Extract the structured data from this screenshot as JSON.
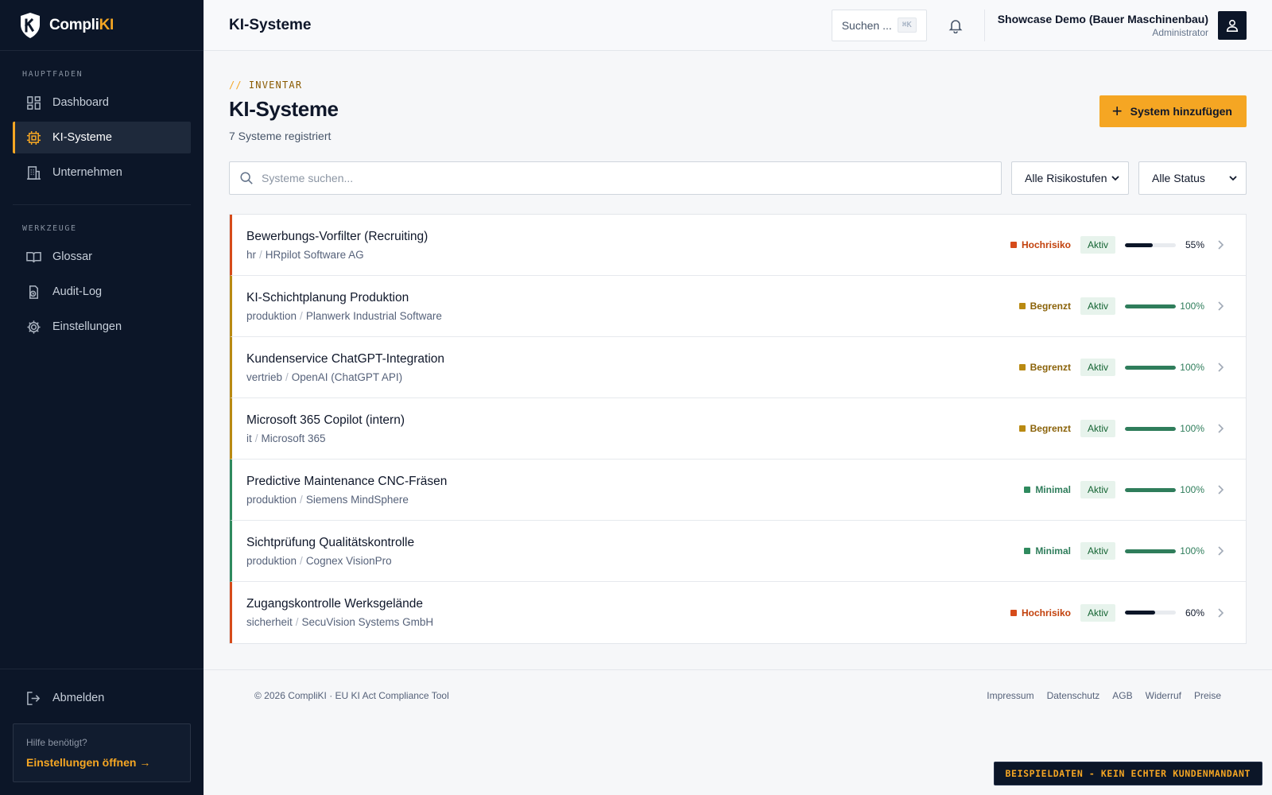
{
  "brand": {
    "name_main": "Compli",
    "name_accent": "KI"
  },
  "sidebar": {
    "sections": [
      {
        "title": "HAUPTFADEN",
        "items": [
          {
            "label": "Dashboard",
            "icon": "dashboard-icon"
          },
          {
            "label": "KI-Systeme",
            "icon": "chip-icon",
            "active": true
          },
          {
            "label": "Unternehmen",
            "icon": "building-icon"
          }
        ]
      },
      {
        "title": "WERKZEUGE",
        "items": [
          {
            "label": "Glossar",
            "icon": "book-icon"
          },
          {
            "label": "Audit-Log",
            "icon": "audit-log-icon"
          },
          {
            "label": "Einstellungen",
            "icon": "gear-icon"
          }
        ]
      }
    ],
    "logout_label": "Abmelden",
    "help": {
      "question": "Hilfe benötigt?",
      "link": "Einstellungen öffnen →"
    }
  },
  "topbar": {
    "title": "KI-Systeme",
    "search_label": "Suchen ...",
    "search_kbd": "⌘K",
    "user_name": "Showcase Demo (Bauer Maschinenbau)",
    "user_role": "Administrator"
  },
  "page": {
    "eyebrow_slashes": "//",
    "eyebrow": "INVENTAR",
    "title": "KI-Systeme",
    "subtitle": "7 Systeme registriert",
    "add_button": "System hinzufügen",
    "search_placeholder": "Systeme suchen...",
    "risk_filter": "Alle Risikostufen",
    "status_filter": "Alle Status"
  },
  "colors": {
    "accent": "#f5a623",
    "risk_high": "#d64b1a",
    "risk_limited": "#b98a12",
    "risk_minimal": "#2f8a5e",
    "progress_dark": "#0c1628",
    "progress_green": "#2f7d5b"
  },
  "systems": [
    {
      "name": "Bewerbungs-Vorfilter (Recruiting)",
      "dept": "hr",
      "vendor": "HRpilot Software AG",
      "risk": "Hochrisiko",
      "risk_level": "high",
      "status": "Aktiv",
      "progress": 55,
      "progress_label": "55%"
    },
    {
      "name": "KI-Schichtplanung Produktion",
      "dept": "produktion",
      "vendor": "Planwerk Industrial Software",
      "risk": "Begrenzt",
      "risk_level": "limited",
      "status": "Aktiv",
      "progress": 100,
      "progress_label": "100%"
    },
    {
      "name": "Kundenservice ChatGPT-Integration",
      "dept": "vertrieb",
      "vendor": "OpenAI (ChatGPT API)",
      "risk": "Begrenzt",
      "risk_level": "limited",
      "status": "Aktiv",
      "progress": 100,
      "progress_label": "100%"
    },
    {
      "name": "Microsoft 365 Copilot (intern)",
      "dept": "it",
      "vendor": "Microsoft 365",
      "risk": "Begrenzt",
      "risk_level": "limited",
      "status": "Aktiv",
      "progress": 100,
      "progress_label": "100%"
    },
    {
      "name": "Predictive Maintenance CNC-Fräsen",
      "dept": "produktion",
      "vendor": "Siemens MindSphere",
      "risk": "Minimal",
      "risk_level": "minimal",
      "status": "Aktiv",
      "progress": 100,
      "progress_label": "100%"
    },
    {
      "name": "Sichtprüfung Qualitätskontrolle",
      "dept": "produktion",
      "vendor": "Cognex VisionPro",
      "risk": "Minimal",
      "risk_level": "minimal",
      "status": "Aktiv",
      "progress": 100,
      "progress_label": "100%"
    },
    {
      "name": "Zugangskontrolle Werksgelände",
      "dept": "sicherheit",
      "vendor": "SecuVision Systems GmbH",
      "risk": "Hochrisiko",
      "risk_level": "high",
      "status": "Aktiv",
      "progress": 60,
      "progress_label": "60%"
    }
  ],
  "footer": {
    "copyright": "© 2026 CompliKI · EU KI Act Compliance Tool",
    "links": [
      "Impressum",
      "Datenschutz",
      "AGB",
      "Widerruf",
      "Preise"
    ]
  },
  "demo_badge": "BEISPIELDATEN - KEIN ECHTER KUNDENMANDANT"
}
